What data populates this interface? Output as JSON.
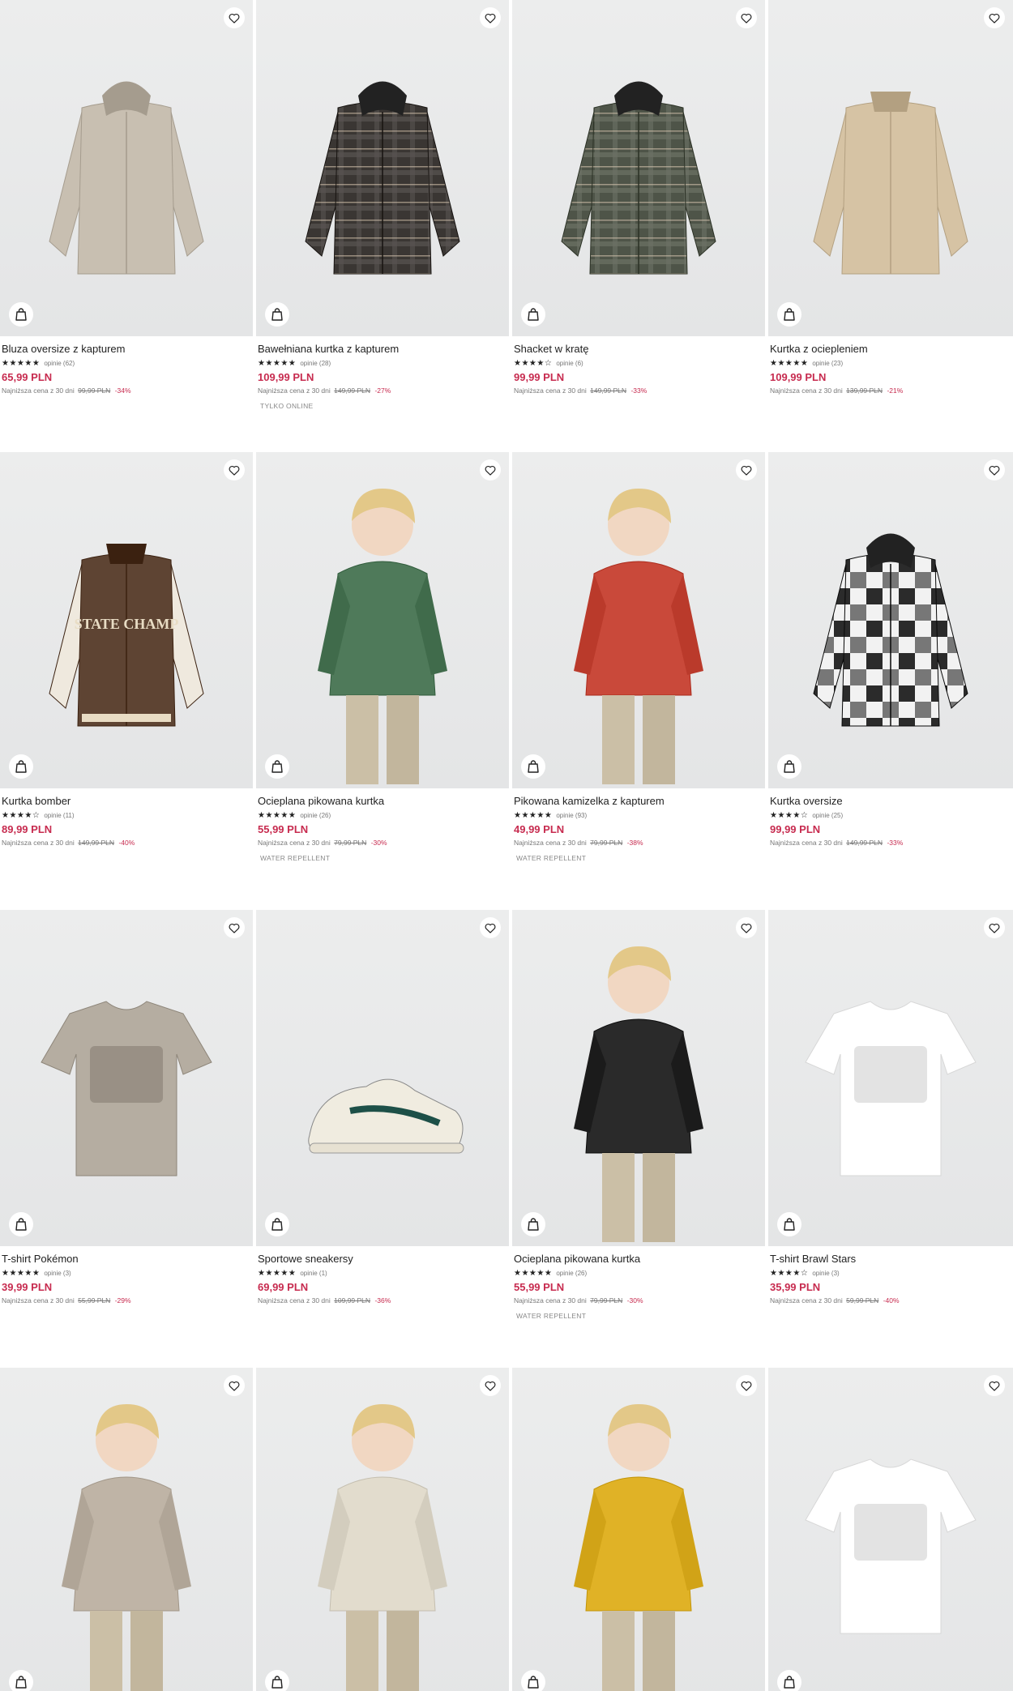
{
  "products": [
    {
      "name": "Bluza oversize z kapturem",
      "stars": "★★★★★",
      "reviews": "opinie (62)",
      "price": "65,99 PLN",
      "lowest_label": "Najniższa cena z 30 dni",
      "old_price": "99,99 PLN",
      "discount": "-34%",
      "tag": "",
      "art": "hoodie",
      "color": "#c8bfb1"
    },
    {
      "name": "Bawełniana kurtka z kapturem",
      "stars": "★★★★★",
      "reviews": "opinie (28)",
      "price": "109,99 PLN",
      "lowest_label": "Najniższa cena z 30 dni",
      "old_price": "149,99 PLN",
      "discount": "-27%",
      "tag": "TYLKO ONLINE",
      "art": "plaid",
      "color": "#3a3633"
    },
    {
      "name": "Shacket w kratę",
      "stars": "★★★★☆",
      "reviews": "opinie (6)",
      "price": "99,99 PLN",
      "lowest_label": "Najniższa cena z 30 dni",
      "old_price": "149,99 PLN",
      "discount": "-33%",
      "tag": "",
      "art": "plaid",
      "color": "#4e5448"
    },
    {
      "name": "Kurtka z ociepleniem",
      "stars": "★★★★★",
      "reviews": "opinie (23)",
      "price": "109,99 PLN",
      "lowest_label": "Najniższa cena z 30 dni",
      "old_price": "139,99 PLN",
      "discount": "-21%",
      "tag": "",
      "art": "fleece",
      "color": "#d6c3a4"
    },
    {
      "name": "Kurtka bomber",
      "stars": "★★★★☆",
      "reviews": "opinie (11)",
      "price": "89,99 PLN",
      "lowest_label": "Najniższa cena z 30 dni",
      "old_price": "149,99 PLN",
      "discount": "-40%",
      "tag": "",
      "art": "bomber",
      "color": "#5e4433"
    },
    {
      "name": "Ocieplana pikowana kurtka",
      "stars": "★★★★★",
      "reviews": "opinie (26)",
      "price": "55,99 PLN",
      "lowest_label": "Najniższa cena z 30 dni",
      "old_price": "79,99 PLN",
      "discount": "-30%",
      "tag": "WATER REPELLENT",
      "art": "kid",
      "color": "#4f7a5a"
    },
    {
      "name": "Pikowana kamizelka z kapturem",
      "stars": "★★★★★",
      "reviews": "opinie (93)",
      "price": "49,99 PLN",
      "lowest_label": "Najniższa cena z 30 dni",
      "old_price": "79,99 PLN",
      "discount": "-38%",
      "tag": "WATER REPELLENT",
      "art": "kid",
      "color": "#c9493a"
    },
    {
      "name": "Kurtka oversize",
      "stars": "★★★★☆",
      "reviews": "opinie (25)",
      "price": "99,99 PLN",
      "lowest_label": "Najniższa cena z 30 dni",
      "old_price": "149,99 PLN",
      "discount": "-33%",
      "tag": "",
      "art": "check",
      "color": "#2b2b2b"
    },
    {
      "name": "T-shirt Pokémon",
      "stars": "★★★★★",
      "reviews": "opinie (3)",
      "price": "39,99 PLN",
      "lowest_label": "Najniższa cena z 30 dni",
      "old_price": "55,99 PLN",
      "discount": "-29%",
      "tag": "",
      "art": "tshirt",
      "color": "#b5ada1"
    },
    {
      "name": "Sportowe sneakersy",
      "stars": "★★★★★",
      "reviews": "opinie (1)",
      "price": "69,99 PLN",
      "lowest_label": "Najniższa cena z 30 dni",
      "old_price": "109,99 PLN",
      "discount": "-36%",
      "tag": "",
      "art": "shoe",
      "color": "#f0ece0"
    },
    {
      "name": "Ocieplana pikowana kurtka",
      "stars": "★★★★★",
      "reviews": "opinie (26)",
      "price": "55,99 PLN",
      "lowest_label": "Najniższa cena z 30 dni",
      "old_price": "79,99 PLN",
      "discount": "-30%",
      "tag": "WATER REPELLENT",
      "art": "kid",
      "color": "#2a2a2a"
    },
    {
      "name": "T-shirt Brawl Stars",
      "stars": "★★★★☆",
      "reviews": "opinie (3)",
      "price": "35,99 PLN",
      "lowest_label": "Najniższa cena z 30 dni",
      "old_price": "59,99 PLN",
      "discount": "-40%",
      "tag": "",
      "art": "tshirt",
      "color": "#ffffff"
    },
    {
      "name": "",
      "stars": "",
      "reviews": "",
      "price": "",
      "lowest_label": "",
      "old_price": "",
      "discount": "",
      "tag": "",
      "art": "kid",
      "color": "#bfb4a6"
    },
    {
      "name": "",
      "stars": "",
      "reviews": "",
      "price": "",
      "lowest_label": "",
      "old_price": "",
      "discount": "",
      "tag": "",
      "art": "kid",
      "color": "#e2dccd"
    },
    {
      "name": "",
      "stars": "",
      "reviews": "",
      "price": "",
      "lowest_label": "",
      "old_price": "",
      "discount": "",
      "tag": "",
      "art": "kid",
      "color": "#e0b226"
    },
    {
      "name": "",
      "stars": "",
      "reviews": "",
      "price": "",
      "lowest_label": "",
      "old_price": "",
      "discount": "",
      "tag": "",
      "art": "tshirt",
      "color": "#ffffff"
    }
  ],
  "icons": {
    "favorite": "heart-icon",
    "add_to_bag": "shopping-bag-icon"
  }
}
